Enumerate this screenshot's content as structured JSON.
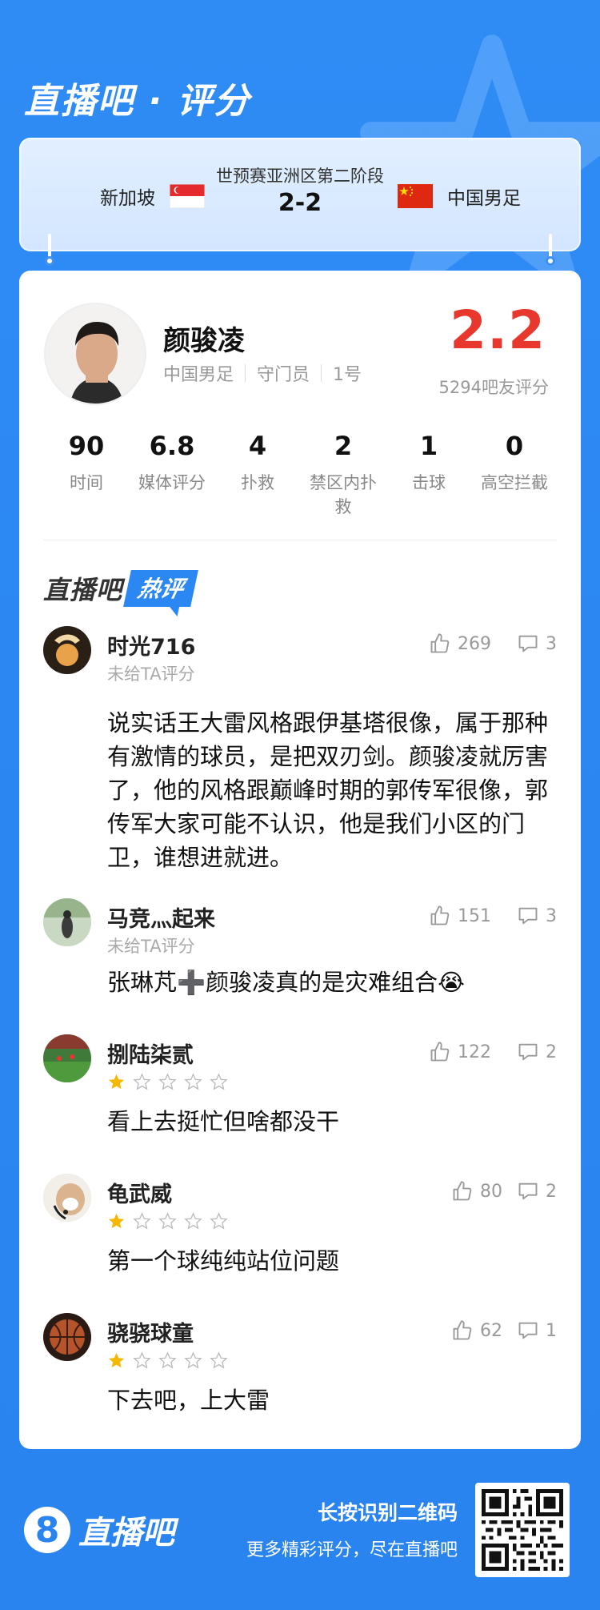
{
  "brand": {
    "title": "直播吧 · 评分"
  },
  "match": {
    "stage": "世预赛亚洲区第二阶段",
    "score": "2-2",
    "home": {
      "name": "新加坡",
      "flag": "singapore-flag-icon"
    },
    "away": {
      "name": "中国男足",
      "flag": "china-flag-icon"
    }
  },
  "player": {
    "name": "颜骏凌",
    "team": "中国男足",
    "position": "守门员",
    "number": "1号",
    "rating": "2.2",
    "rating_count": "5294吧友评分"
  },
  "stats": [
    {
      "value": "90",
      "label": "时间"
    },
    {
      "value": "6.8",
      "label": "媒体评分"
    },
    {
      "value": "4",
      "label": "扑救"
    },
    {
      "value": "2",
      "label": "禁区内扑救"
    },
    {
      "value": "1",
      "label": "击球"
    },
    {
      "value": "0",
      "label": "高空拦截"
    }
  ],
  "hot": {
    "brand": "直播吧",
    "badge": "热评"
  },
  "comments": [
    {
      "user": "时光716",
      "sub": "未给TA评分",
      "likes": "269",
      "replies": "3",
      "text": "说实话王大雷风格跟伊基塔很像，属于那种有激情的球员，是把双刃剑。颜骏凌就厉害了，他的风格跟巅峰时期的郭传军很像，郭传军大家可能不认识，他是我们小区的门卫，谁想进就进。"
    },
    {
      "user": "马竞灬起来",
      "sub": "未给TA评分",
      "likes": "151",
      "replies": "3",
      "text": "张琳芃➕颜骏凌真的是灾难组合😭"
    },
    {
      "user": "捌陆柒贰",
      "rating": 1,
      "likes": "122",
      "replies": "2",
      "text": "看上去挺忙但啥都没干"
    },
    {
      "user": "龟武威",
      "rating": 1,
      "likes": "80",
      "replies": "2",
      "text": "第一个球纯纯站位问题"
    },
    {
      "user": "骁骁球童",
      "rating": 1,
      "likes": "62",
      "replies": "1",
      "text": "下去吧，上大雷"
    }
  ],
  "footer": {
    "logo_digit": "8",
    "brand": "直播吧",
    "cta_line1": "长按识别二维码",
    "cta_line2": "更多精彩评分，尽在直播吧"
  },
  "colors": {
    "background": "#2c87f2",
    "rating_red": "#e8382d",
    "star_gold": "#f5b800"
  }
}
